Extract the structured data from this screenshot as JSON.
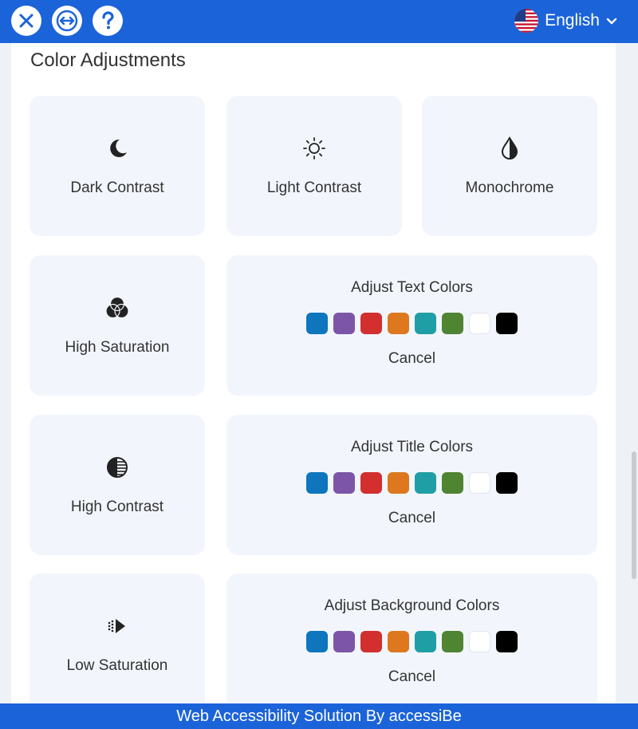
{
  "header": {
    "buttons": [
      {
        "icon": "close-icon"
      },
      {
        "icon": "expand-arrows-icon"
      },
      {
        "icon": "help-icon"
      }
    ],
    "language": {
      "label": "English",
      "icon": "us-flag-icon"
    },
    "accent": "#1b63d9"
  },
  "section": {
    "title": "Color Adjustments"
  },
  "tiles": [
    {
      "label": "Dark Contrast",
      "icon": "moon-icon"
    },
    {
      "label": "Light Contrast",
      "icon": "sun-icon"
    },
    {
      "label": "Monochrome",
      "icon": "droplet-icon"
    },
    {
      "label": "High Saturation",
      "icon": "color-circles-icon"
    },
    {
      "label": "High Contrast",
      "icon": "contrast-icon"
    },
    {
      "label": "Low Saturation",
      "icon": "desaturate-icon"
    }
  ],
  "adjusters": [
    {
      "title": "Adjust Text Colors",
      "cancel": "Cancel"
    },
    {
      "title": "Adjust Title Colors",
      "cancel": "Cancel"
    },
    {
      "title": "Adjust Background Colors",
      "cancel": "Cancel"
    }
  ],
  "palette": [
    "#0d76bd",
    "#7c55a8",
    "#d22f2f",
    "#dd781f",
    "#1f9fa5",
    "#4f8432",
    "#ffffff",
    "#000000"
  ],
  "footer": {
    "text": "Web Accessibility Solution By accessiBe"
  }
}
